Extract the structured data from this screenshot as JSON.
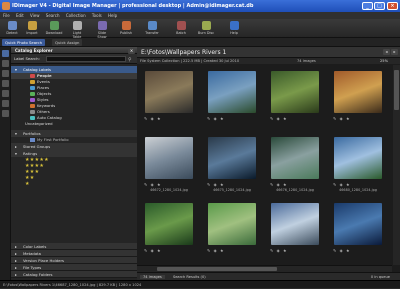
{
  "window": {
    "title": "IDimager V4 - Digital Image Manager | professional desktop | Admin@idimager.cat.db"
  },
  "menu": [
    "File",
    "Edit",
    "View",
    "Search",
    "Collection",
    "Tools",
    "Help"
  ],
  "toolbar": {
    "buttons": [
      {
        "label": "Detect",
        "color": "#6a8cc8"
      },
      {
        "label": "Import",
        "color": "#c8a040"
      },
      {
        "label": "Download",
        "color": "#5a9a5a"
      },
      {
        "label": "Light Table",
        "color": "#b0b0b0"
      },
      {
        "label": "Slide Show",
        "color": "#7a6ab0"
      },
      {
        "label": "Publish",
        "color": "#c86a3a"
      },
      {
        "label": "Transfer",
        "color": "#5a8ac8"
      },
      {
        "label": "Batch",
        "color": "#a05050"
      },
      {
        "label": "Burn Disc",
        "color": "#9aaa50"
      },
      {
        "label": "Help",
        "color": "#3a70c8"
      }
    ]
  },
  "quickbar": {
    "search": "Quick Photo Search",
    "assign": "Quick Assign"
  },
  "panel": {
    "title": "Catalog Explorer",
    "label_search": "Label Search:",
    "root": "Catalog Labels",
    "labels": [
      {
        "name": "People",
        "color": "#d04a4a"
      },
      {
        "name": "Events",
        "color": "#d0a030"
      },
      {
        "name": "Places",
        "color": "#4a9ad0"
      },
      {
        "name": "Objects",
        "color": "#5ab05a"
      },
      {
        "name": "Styles",
        "color": "#a05ad0"
      },
      {
        "name": "Keywords",
        "color": "#d07030"
      },
      {
        "name": "Others",
        "color": "#8a8a8a"
      },
      {
        "name": "Auto Catalog",
        "color": "#4ac0c0"
      },
      {
        "name": "Uncategorized",
        "color": "#666666"
      }
    ],
    "portfolios": "Portfolios",
    "first_portfolio": "My First Portfolio",
    "stored_groups": "Stored Groups",
    "ratings": "Ratings",
    "rating_rows": [
      "★★★★★",
      "★★★★",
      "★★★",
      "★★",
      "★"
    ],
    "sections": [
      "Color Labels",
      "Metadata",
      "Version Place Holders",
      "File Types",
      "Catalog Folders"
    ]
  },
  "main": {
    "path": "E:\\Fotos\\Wallpapers Rivers 1",
    "info": "File System Collection | 222.5 MB | Created 30 Jul 2010",
    "info_right": "74 images",
    "zoom": "25%",
    "photos": [
      {
        "file": "",
        "colors": [
          "#5a4a3a",
          "#8a7a5a",
          "#2a2a2a"
        ]
      },
      {
        "file": "",
        "colors": [
          "#3a6aa0",
          "#7aa0c0",
          "#2a4a2a"
        ]
      },
      {
        "file": "",
        "colors": [
          "#3a5a2a",
          "#7a9a4a",
          "#2a3a1a"
        ]
      },
      {
        "file": "",
        "colors": [
          "#a05a2a",
          "#d0a050",
          "#3a2a1a"
        ]
      },
      {
        "file": "46672_1280_1024.jpg",
        "colors": [
          "#ccd0d4",
          "#7a8a9a",
          "#3a4a5a"
        ]
      },
      {
        "file": "46675_1280_1024.jpg",
        "colors": [
          "#2a3a4a",
          "#5a7a9a",
          "#0a1a2a"
        ]
      },
      {
        "file": "46676_1280_1024.jpg",
        "colors": [
          "#2a4a3a",
          "#8aa0a0",
          "#4a7a5a"
        ]
      },
      {
        "file": "46680_1280_1024.jpg",
        "colors": [
          "#3a6aa0",
          "#a0c0e0",
          "#2a5a2a"
        ]
      },
      {
        "file": "",
        "colors": [
          "#2a5a2a",
          "#6a9a4a",
          "#1a3a1a"
        ]
      },
      {
        "file": "",
        "colors": [
          "#5a9a4a",
          "#a0c080",
          "#3a6a3a"
        ]
      },
      {
        "file": "",
        "colors": [
          "#4a6a9a",
          "#c0d0e0",
          "#3a4a5a"
        ]
      },
      {
        "file": "",
        "colors": [
          "#1a3a6a",
          "#4a7ab0",
          "#0a1a3a"
        ]
      }
    ],
    "bottom_tabs": [
      "74 images",
      "Search Results (0)"
    ],
    "bottom_right": "0 in queue"
  },
  "statusbar": "E:\\Fotos\\Wallpapers Rivers 1\\46687_1280_1024.jpg | 829.7 KB | 1280 x 1024"
}
